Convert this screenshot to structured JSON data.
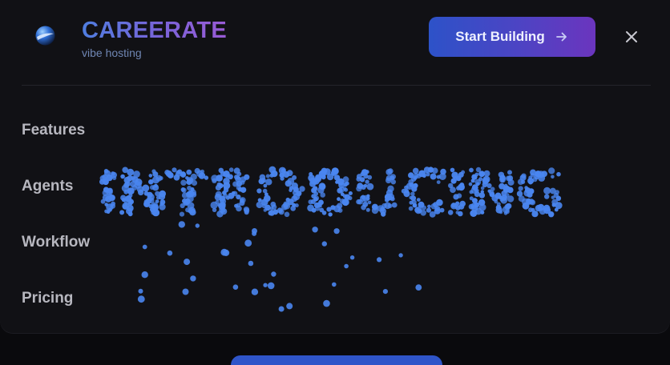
{
  "brand": {
    "name": "CAREERATE",
    "tagline": "vibe hosting",
    "logo_icon": "sphere-logo-icon"
  },
  "header": {
    "cta_label": "Start Building",
    "cta_icon": "arrow-right-icon",
    "close_icon": "close-icon"
  },
  "nav": {
    "items": [
      {
        "label": "Features"
      },
      {
        "label": "Agents"
      },
      {
        "label": "Workflow"
      },
      {
        "label": "Pricing"
      }
    ]
  },
  "particle_text": {
    "word": "INTRODUCING",
    "color": "#4a86f0"
  },
  "colors": {
    "background": "#111115",
    "accent_start": "#2d52c8",
    "accent_end": "#6b35be",
    "particle": "#4a86f0"
  }
}
